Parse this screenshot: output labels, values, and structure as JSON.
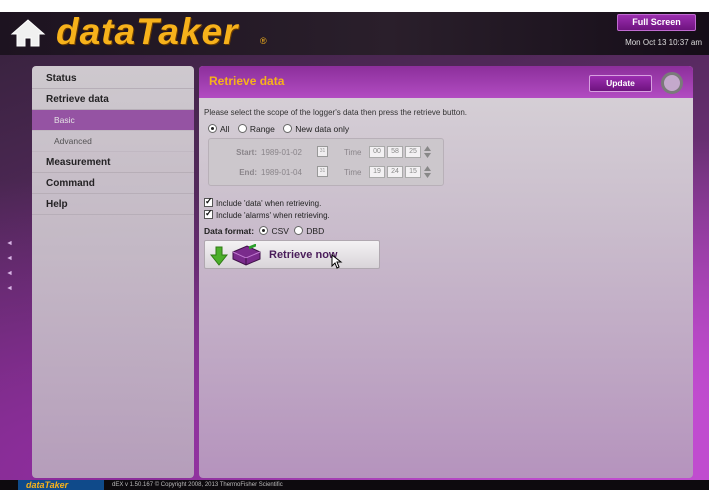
{
  "header": {
    "brand": "dataTaker",
    "registered": "®",
    "fullscreen_label": "Full Screen",
    "datetime": "Mon Oct 13  10:37 am",
    "home_icon": "home-icon"
  },
  "sidebar": {
    "items": [
      {
        "label": "Status"
      },
      {
        "label": "Retrieve data"
      },
      {
        "label": "Basic"
      },
      {
        "label": "Advanced"
      },
      {
        "label": "Measurement"
      },
      {
        "label": "Command"
      },
      {
        "label": "Help"
      }
    ],
    "active": "Basic"
  },
  "main": {
    "title": "Retrieve data",
    "update_label": "Update",
    "instruction": "Please select the scope of the logger's data then press the retrieve button.",
    "scope": {
      "options": [
        "All",
        "Range",
        "New data only"
      ],
      "selected": "All"
    },
    "range": {
      "start_label": "Start:",
      "start_date": "1989-01-02",
      "end_label": "End:",
      "end_date": "1989-01-04",
      "time_label": "Time",
      "start_time": [
        "00",
        "58",
        "25"
      ],
      "end_time": [
        "19",
        "24",
        "15"
      ]
    },
    "checks": [
      {
        "label": "Include 'data' when retrieving.",
        "checked": true
      },
      {
        "label": "Include 'alarms' when retrieving.",
        "checked": true
      }
    ],
    "format": {
      "label": "Data format:",
      "options": [
        "CSV",
        "DBD"
      ],
      "selected": "CSV"
    },
    "retrieve_label": "Retrieve now"
  },
  "footer": {
    "brand": "dataTaker",
    "text": "dEX v 1.50.167  © Copyright 2008, 2013 ThermoFisher Scientific"
  },
  "colors": {
    "accent": "#9b2eb0",
    "brand": "#f7b21b"
  }
}
